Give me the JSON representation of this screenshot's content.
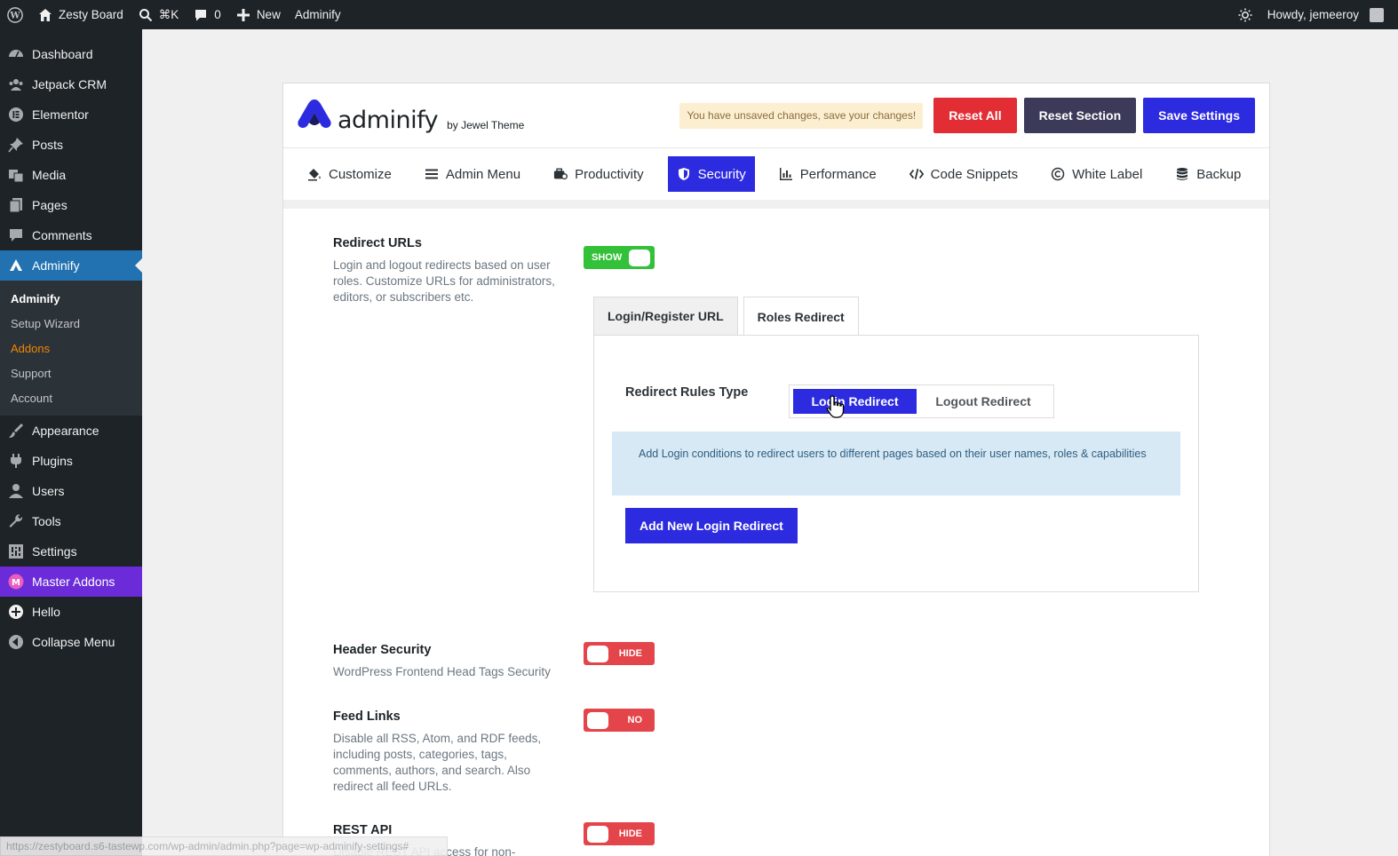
{
  "adminbar": {
    "site_name": "Zesty Board",
    "search_shortcut": "⌘K",
    "comments_count": "0",
    "new_label": "New",
    "plugin_label": "Adminify",
    "greeting": "Howdy, jemeeroy"
  },
  "sidebar": {
    "items_top": [
      {
        "label": "Dashboard",
        "icon": "dashboard-icon"
      },
      {
        "label": "Jetpack CRM",
        "icon": "crm-icon"
      },
      {
        "label": "Elementor",
        "icon": "elementor-icon"
      },
      {
        "label": "Posts",
        "icon": "pin-icon"
      },
      {
        "label": "Media",
        "icon": "media-icon"
      },
      {
        "label": "Pages",
        "icon": "pages-icon"
      },
      {
        "label": "Comments",
        "icon": "comment-icon"
      },
      {
        "label": "Adminify",
        "icon": "adminify-icon"
      }
    ],
    "submenu": [
      "Adminify",
      "Setup Wizard",
      "Addons",
      "Support",
      "Account"
    ],
    "items_bottom": [
      {
        "label": "Appearance",
        "icon": "brush-icon"
      },
      {
        "label": "Plugins",
        "icon": "plug-icon"
      },
      {
        "label": "Users",
        "icon": "user-icon"
      },
      {
        "label": "Tools",
        "icon": "wrench-icon"
      },
      {
        "label": "Settings",
        "icon": "settings-icon"
      },
      {
        "label": "Master Addons",
        "icon": "master-addons-icon"
      },
      {
        "label": "Hello",
        "icon": "plus-circle-icon"
      },
      {
        "label": "Collapse Menu",
        "icon": "collapse-icon"
      }
    ]
  },
  "header": {
    "brand": "adminify",
    "brand_by": "by Jewel Theme",
    "unsaved_notice": "You have unsaved changes, save your changes!",
    "reset_all": "Reset All",
    "reset_section": "Reset Section",
    "save_settings": "Save Settings"
  },
  "tabs": [
    {
      "label": "Customize",
      "icon": "paint-bucket-icon"
    },
    {
      "label": "Admin Menu",
      "icon": "menu-lines-icon"
    },
    {
      "label": "Productivity",
      "icon": "productivity-icon"
    },
    {
      "label": "Security",
      "icon": "shield-icon"
    },
    {
      "label": "Performance",
      "icon": "bar-chart-icon"
    },
    {
      "label": "Code Snippets",
      "icon": "code-icon"
    },
    {
      "label": "White Label",
      "icon": "copyright-icon"
    },
    {
      "label": "Backup",
      "icon": "database-icon"
    }
  ],
  "settings": {
    "redirect": {
      "title": "Redirect URLs",
      "desc": "Login and logout redirects based on user roles. Customize URLs for administrators, editors, or subscribers etc.",
      "toggle": "SHOW"
    },
    "inner_tabs": [
      "Login/Register URL",
      "Roles Redirect"
    ],
    "rules_label": "Redirect Rules Type",
    "segment": [
      "Login Redirect",
      "Logout Redirect"
    ],
    "notice": "Add Login conditions to redirect users to different pages based on their user names, roles & capabilities",
    "add_button": "Add New Login Redirect",
    "header_security": {
      "title": "Header Security",
      "desc": "WordPress Frontend Head Tags Security",
      "toggle": "HIDE"
    },
    "feed_links": {
      "title": "Feed Links",
      "desc": "Disable all RSS, Atom, and RDF feeds, including posts, categories, tags, comments, authors, and search. Also redirect all feed URLs.",
      "toggle": "NO"
    },
    "rest_api": {
      "title": "REST API",
      "desc": "Disable REST API access for non-",
      "toggle": "HIDE"
    }
  },
  "statusbar": "https://zestyboard.s6-tastewp.com/wp-admin/admin.php?page=wp-adminify-settings#",
  "colors": {
    "primary": "#2d2be0",
    "danger": "#e22d35",
    "dark": "#3b3a58",
    "toggle_on": "#34c13a",
    "toggle_off": "#e4454b",
    "wp_blue": "#2271b1"
  }
}
